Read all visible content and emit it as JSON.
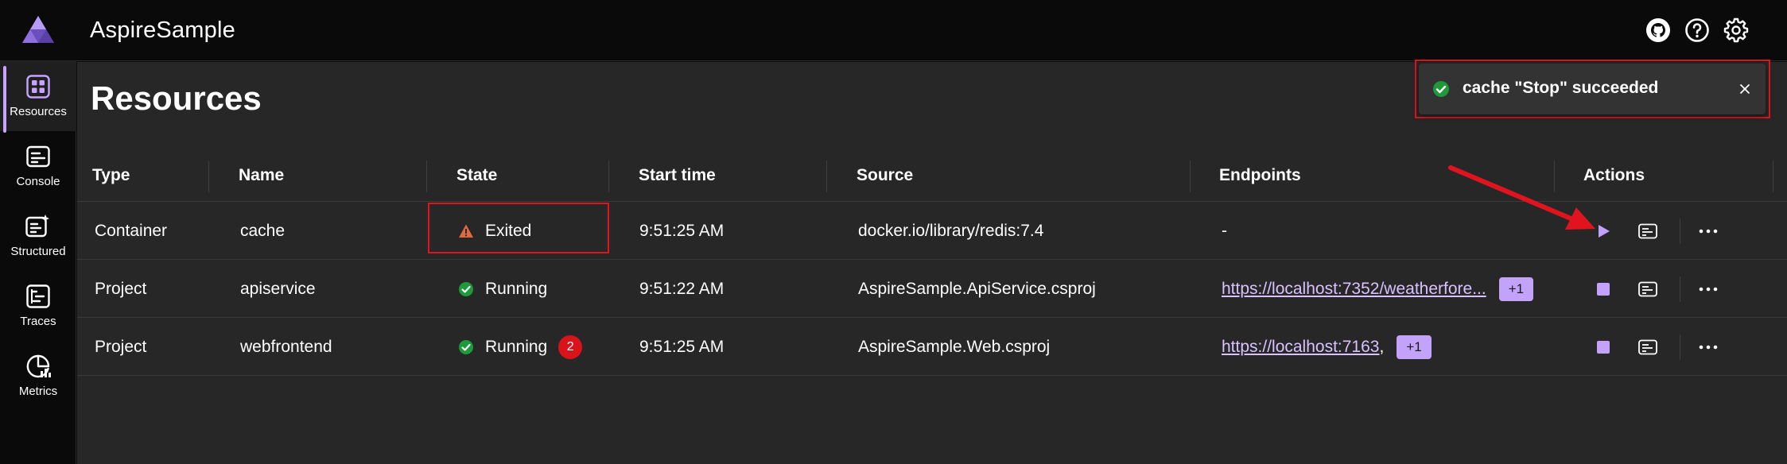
{
  "app": {
    "title": "AspireSample"
  },
  "header_icons": [
    "github-icon",
    "help-icon",
    "settings-icon"
  ],
  "nav": {
    "items": [
      {
        "label": "Resources",
        "icon": "resources-icon",
        "active": true
      },
      {
        "label": "Console",
        "icon": "console-icon",
        "active": false
      },
      {
        "label": "Structured",
        "icon": "structured-icon",
        "active": false
      },
      {
        "label": "Traces",
        "icon": "traces-icon",
        "active": false
      },
      {
        "label": "Metrics",
        "icon": "metrics-icon",
        "active": false
      }
    ]
  },
  "page": {
    "title": "Resources"
  },
  "table": {
    "columns": [
      "Type",
      "Name",
      "State",
      "Start time",
      "Source",
      "Endpoints",
      "Actions"
    ],
    "rows": [
      {
        "type": "Container",
        "name": "cache",
        "state": "Exited",
        "state_kind": "warning",
        "start_time": "9:51:25 AM",
        "source": "docker.io/library/redis:7.4",
        "endpoint": "-",
        "endpoint_extra": "",
        "primary_action": "start"
      },
      {
        "type": "Project",
        "name": "apiservice",
        "state": "Running",
        "state_kind": "running",
        "start_time": "9:51:22 AM",
        "source": "AspireSample.ApiService.csproj",
        "endpoint": "https://localhost:7352/weatherfore...",
        "endpoint_extra": "+1",
        "primary_action": "stop"
      },
      {
        "type": "Project",
        "name": "webfrontend",
        "state": "Running",
        "state_kind": "running",
        "error_count": "2",
        "start_time": "9:51:25 AM",
        "source": "AspireSample.Web.csproj",
        "endpoint": "https://localhost:7163",
        "endpoint_suffix": ",",
        "endpoint_extra": "+1",
        "primary_action": "stop"
      }
    ]
  },
  "toast": {
    "message": "cache \"Stop\" succeeded"
  },
  "colors": {
    "accent": "#c3a2fa",
    "running": "#1e9a3a",
    "warning": "#e06a3b",
    "error_badge": "#d8131a",
    "highlight": "#e0141e"
  }
}
